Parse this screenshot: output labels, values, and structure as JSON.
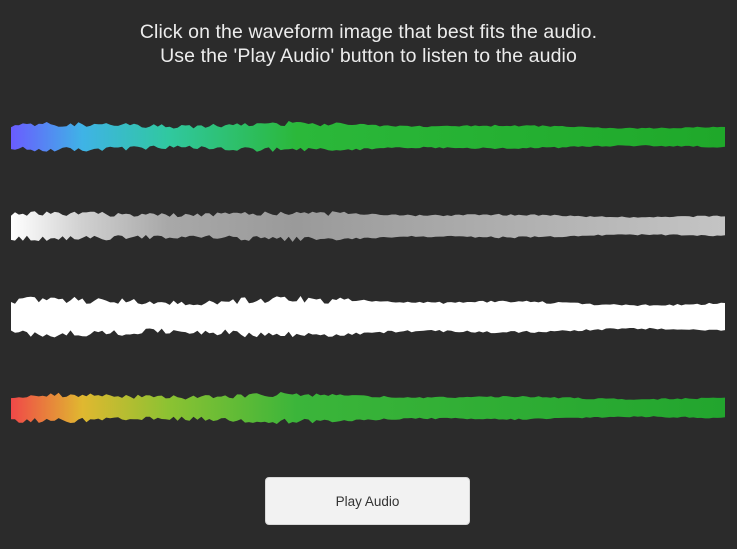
{
  "instructions": {
    "line1": "Click on the waveform image that best fits the audio.",
    "line2": "Use the 'Play Audio' button to listen to the audio"
  },
  "waveforms": [
    {
      "style": "spectrum-blue-cyan-green",
      "colors": [
        "#6a5cff",
        "#3fb3e6",
        "#30c8a0",
        "#2bb83a",
        "#1fa82a"
      ]
    },
    {
      "style": "gray",
      "colors": [
        "#ffffff",
        "#d0d0d0",
        "#a8a8a8",
        "#9a9a9a",
        "#c4c4c4"
      ]
    },
    {
      "style": "white",
      "colors": [
        "#ffffff",
        "#ffffff",
        "#ffffff",
        "#ffffff",
        "#ffffff"
      ]
    },
    {
      "style": "spectrum-red-yellow-green",
      "colors": [
        "#f04848",
        "#e0b830",
        "#8cc232",
        "#3bb53a",
        "#22a52e"
      ]
    }
  ],
  "play_button": {
    "label": "Play Audio"
  }
}
